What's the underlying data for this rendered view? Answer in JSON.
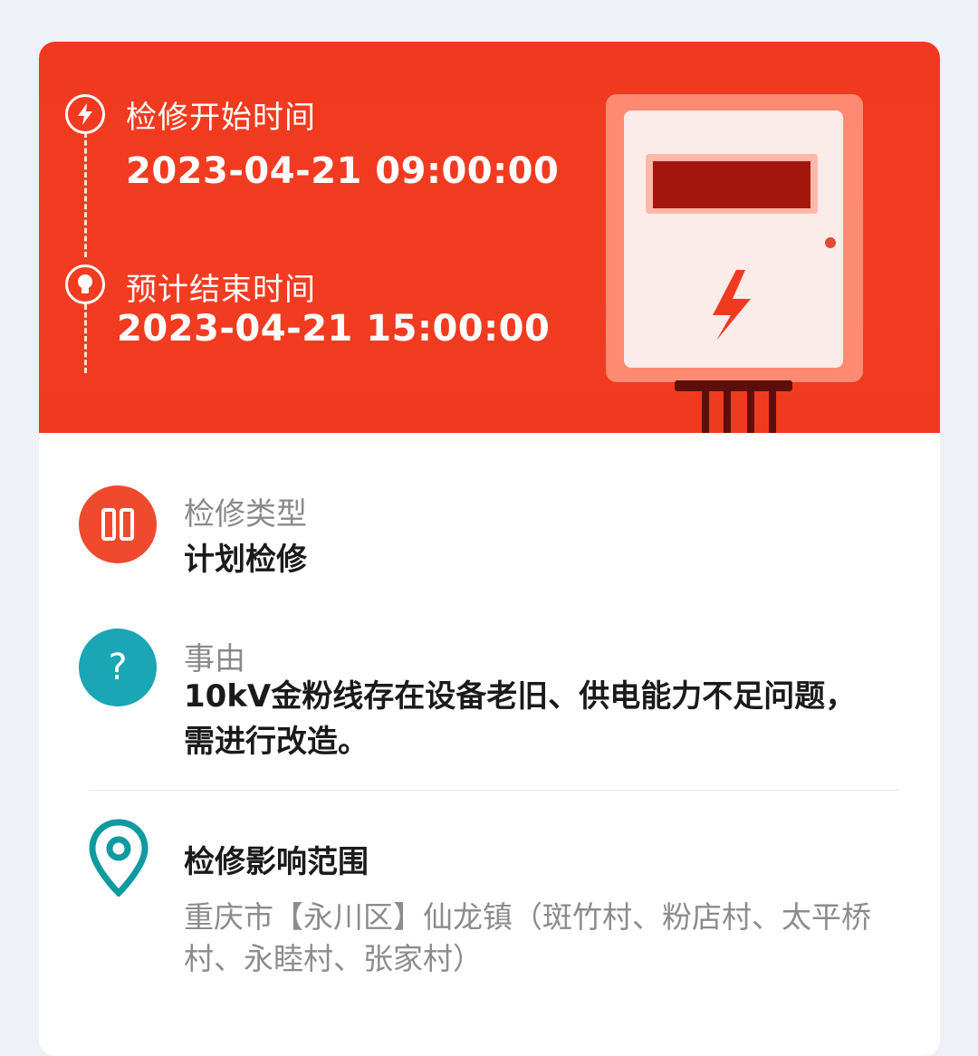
{
  "schedule": {
    "start_label": "检修开始时间",
    "start_time": "2023-04-21 09:00:00",
    "end_label": "预计结束时间",
    "end_time": "2023-04-21 15:00:00",
    "start_icon": "lightning-icon",
    "end_icon": "lightbulb-icon",
    "illustration": "electric-meter-icon"
  },
  "details": {
    "type_label": "检修类型",
    "type_value": "计划检修",
    "type_icon": "maintenance-type-icon",
    "reason_label": "事由",
    "reason_value": "10kV金粉线存在设备老旧、供电能力不足问题，需进行改造。",
    "reason_icon": "question-icon"
  },
  "scope": {
    "title": "检修影响范围",
    "text": "重庆市【永川区】仙龙镇（斑竹村、粉店村、太平桥村、永睦村、张家村）",
    "icon": "location-pin-icon"
  },
  "colors": {
    "banner": "#f23c22",
    "type_icon_bg": "#ef4a2e",
    "reason_icon_bg": "#1aa6b4",
    "pin": "#0f9aa0"
  }
}
